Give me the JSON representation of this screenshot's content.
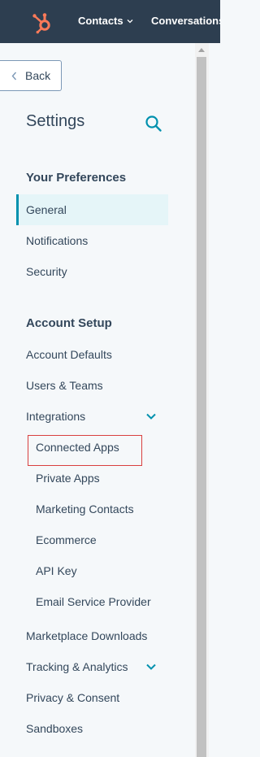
{
  "topnav": {
    "contacts": "Contacts",
    "conversations": "Conversations"
  },
  "back": {
    "label": "Back"
  },
  "settings": {
    "title": "Settings"
  },
  "sections": {
    "preferences": {
      "heading": "Your Preferences",
      "items": [
        "General",
        "Notifications",
        "Security"
      ]
    },
    "account": {
      "heading": "Account Setup",
      "items": [
        "Account Defaults",
        "Users & Teams",
        "Integrations"
      ],
      "integrations_sub": [
        "Connected Apps",
        "Private Apps",
        "Marketing Contacts",
        "Ecommerce",
        "API Key",
        "Email Service Provider"
      ],
      "more": [
        "Marketplace Downloads",
        "Tracking & Analytics",
        "Privacy & Consent",
        "Sandboxes"
      ]
    }
  },
  "colors": {
    "topbar": "#2d3e50",
    "accent": "#0091ae",
    "hubspot_orange": "#ff7a59",
    "highlight": "#d9403f"
  }
}
